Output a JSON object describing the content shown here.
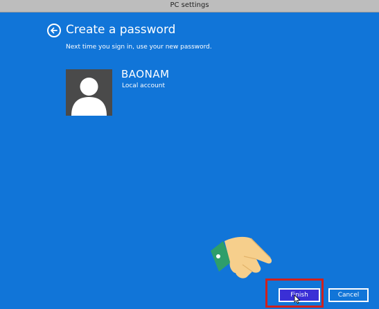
{
  "window": {
    "title": "PC settings"
  },
  "page": {
    "heading": "Create a password",
    "subtext": "Next time you sign in, use your new password.",
    "back_icon": "back-arrow-icon"
  },
  "account": {
    "username": "BAONAM",
    "type": "Local account",
    "avatar_icon": "user-silhouette-icon"
  },
  "buttons": {
    "finish_label": "Finish",
    "cancel_label": "Cancel"
  },
  "colors": {
    "background": "#1175d8",
    "finish_button": "#3a2fd6",
    "highlight_border": "#d0201c"
  }
}
